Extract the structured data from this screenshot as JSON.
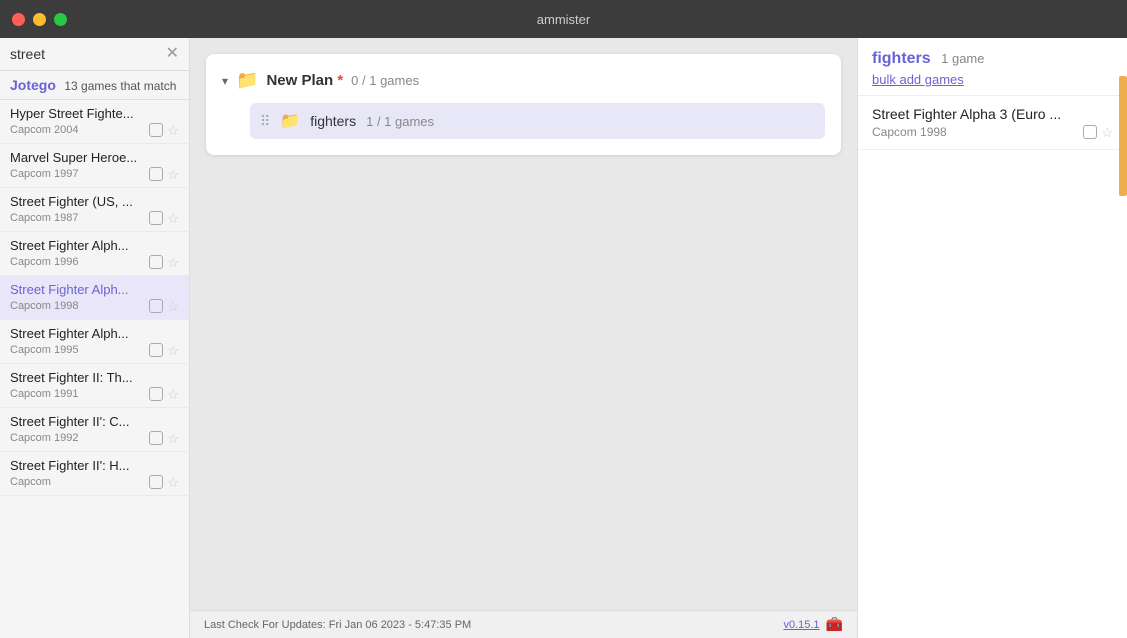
{
  "titlebar": {
    "title": "ammister",
    "close_btn": "close",
    "minimize_btn": "minimize",
    "maximize_btn": "maximize"
  },
  "sidebar": {
    "search_value": "street",
    "brand": "Jotego",
    "match_text": "13 games that match",
    "games": [
      {
        "title": "Hyper Street Fighte...",
        "publisher": "Capcom",
        "year": "2004",
        "active": false,
        "highlight": false
      },
      {
        "title": "Marvel Super Heroe...",
        "publisher": "Capcom",
        "year": "1997",
        "active": false,
        "highlight": false
      },
      {
        "title": "Street Fighter (US, ...",
        "publisher": "Capcom",
        "year": "1987",
        "active": false,
        "highlight": false
      },
      {
        "title": "Street Fighter Alph...",
        "publisher": "Capcom",
        "year": "1996",
        "active": false,
        "highlight": false
      },
      {
        "title": "Street Fighter Alph...",
        "publisher": "Capcom",
        "year": "1998",
        "active": true,
        "highlight": true
      },
      {
        "title": "Street Fighter Alph...",
        "publisher": "Capcom",
        "year": "1995",
        "active": false,
        "highlight": false
      },
      {
        "title": "Street Fighter II: Th...",
        "publisher": "Capcom",
        "year": "1991",
        "active": false,
        "highlight": false
      },
      {
        "title": "Street Fighter II': C...",
        "publisher": "Capcom",
        "year": "1992",
        "active": false,
        "highlight": false
      },
      {
        "title": "Street Fighter II': H...",
        "publisher": "Capcom",
        "year": "",
        "active": false,
        "highlight": false
      }
    ]
  },
  "plan": {
    "title": "New Plan",
    "asterisk": "*",
    "count": "0 / 1 games",
    "folder_item": {
      "name": "fighters",
      "count": "1 / 1 games"
    }
  },
  "right_panel": {
    "title": "fighters",
    "count": "1 game",
    "bulk_add_label": "bulk add games",
    "games": [
      {
        "title": "Street Fighter Alpha 3 (Euro ...",
        "publisher": "Capcom",
        "year": "1998"
      }
    ]
  },
  "status_bar": {
    "text": "Last Check For Updates: Fri Jan 06 2023 - 5:47:35 PM",
    "version": "v0.15.1",
    "chest_icon": "🧰"
  }
}
